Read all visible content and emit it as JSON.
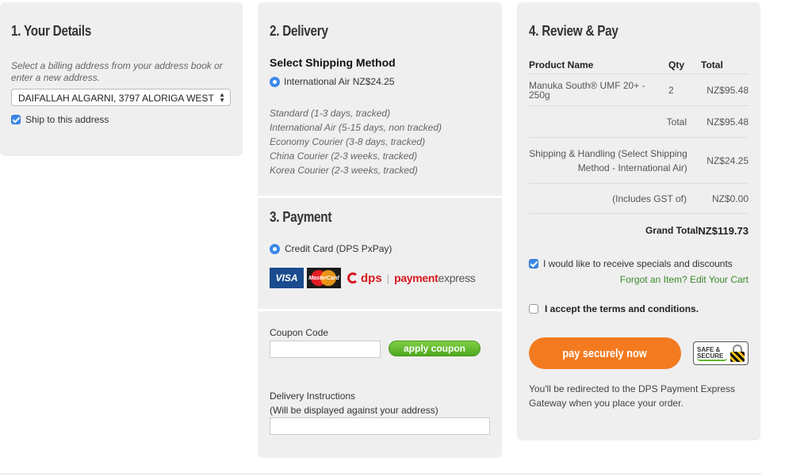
{
  "details": {
    "title": "1. Your Details",
    "hint": "Select a billing address from your address book or enter a new address.",
    "address_selected": "DAIFALLAH ALGARNI, 3797 ALORIGA WEST",
    "ship_to_label": "Ship to this address"
  },
  "delivery": {
    "title": "2. Delivery",
    "method_heading": "Select Shipping Method",
    "selected_method": "International Air NZ$24.25",
    "options": [
      "Standard (1-3 days, tracked)",
      "International Air (5-15 days, non tracked)",
      "Economy Courier (3-8 days, tracked)",
      "China Courier (2-3 weeks, tracked)",
      "Korea Courier (2-3 weeks, tracked)"
    ]
  },
  "payment": {
    "title": "3. Payment",
    "option_label": "Credit Card (DPS PxPay)",
    "visa_label": "VISA",
    "mastercard_label": "MasterCard",
    "dps_label": "dps",
    "gateway_label_bold": "payment",
    "gateway_label_rest": "express"
  },
  "coupon": {
    "label": "Coupon Code",
    "button_label": "apply coupon",
    "delivery_label": "Delivery Instructions",
    "delivery_note": "(Will be displayed against your address)"
  },
  "review": {
    "title": "4. Review & Pay",
    "headers": {
      "name": "Product Name",
      "qty": "Qty",
      "total": "Total"
    },
    "items": [
      {
        "name": "Manuka South® UMF 20+ - 250g",
        "qty": "2",
        "total": "NZ$95.48"
      }
    ],
    "total_label": "Total",
    "total_value": "NZ$95.48",
    "shipping_label": "Shipping & Handling (Select Shipping Method - International Air)",
    "shipping_value": "NZ$24.25",
    "gst_label": "(Includes GST of)",
    "gst_value": "NZ$0.00",
    "grand_label": "Grand Total",
    "grand_value": "NZ$119.73",
    "specials_label": "I would like to receive specials and discounts",
    "forgot_link": "Forgot an Item? Edit Your Cart",
    "terms_label": "I accept the terms and conditions.",
    "pay_button": "pay securely now",
    "badge_line1": "SAFE &",
    "badge_line2": "SECURE",
    "redirect_note": "You'll be redirected to the DPS Payment Express Gateway when you place your order."
  }
}
